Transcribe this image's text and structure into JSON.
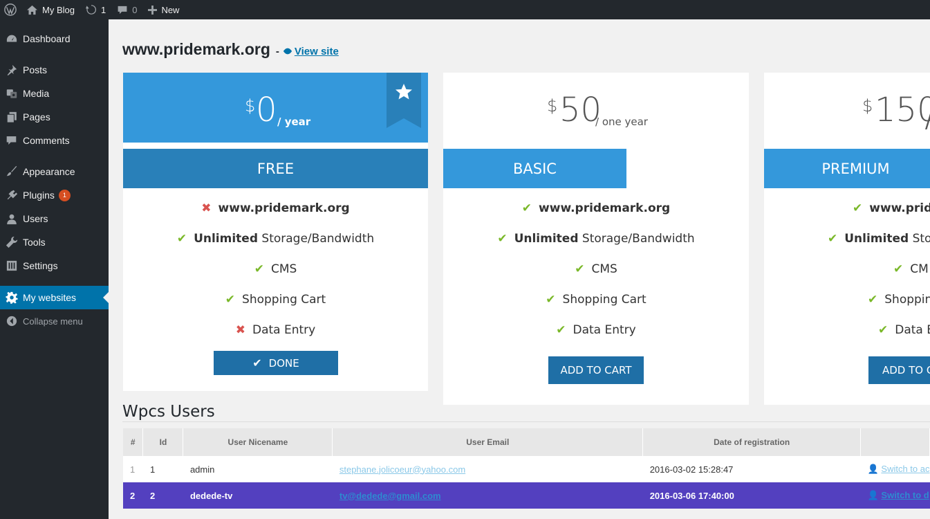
{
  "adminbar": {
    "site_name": "My Blog",
    "updates_count": "1",
    "comments_count": "0",
    "new_label": "New"
  },
  "sidebar": {
    "items": [
      {
        "label": "Dashboard",
        "icon": "dashboard-icon"
      },
      {
        "label": "Posts",
        "icon": "pin-icon"
      },
      {
        "label": "Media",
        "icon": "media-icon"
      },
      {
        "label": "Pages",
        "icon": "pages-icon"
      },
      {
        "label": "Comments",
        "icon": "comment-icon"
      },
      {
        "label": "Appearance",
        "icon": "brush-icon"
      },
      {
        "label": "Plugins",
        "icon": "plug-icon",
        "badge": "1"
      },
      {
        "label": "Users",
        "icon": "user-icon"
      },
      {
        "label": "Tools",
        "icon": "wrench-icon"
      },
      {
        "label": "Settings",
        "icon": "settings-icon"
      },
      {
        "label": "My websites",
        "icon": "gear-icon",
        "active": true
      }
    ],
    "collapse_label": "Collapse menu"
  },
  "page": {
    "title": "www.pridemark.org",
    "separator": "-",
    "view_site": "View site"
  },
  "plans": [
    {
      "currency": "$",
      "amount": "0",
      "period": "/ year",
      "name": "FREE",
      "features": [
        {
          "ok": false,
          "bold": "www.pridemark.org",
          "text": ""
        },
        {
          "ok": true,
          "bold": "Unlimited",
          "text": " Storage/Bandwidth"
        },
        {
          "ok": true,
          "bold": "",
          "text": "CMS"
        },
        {
          "ok": true,
          "bold": "",
          "text": "Shopping Cart"
        },
        {
          "ok": false,
          "bold": "",
          "text": "Data Entry"
        }
      ],
      "button": "DONE"
    },
    {
      "currency": "$",
      "amount": "50",
      "period": "/ one year",
      "name": "BASIC",
      "features": [
        {
          "ok": true,
          "bold": "www.pridemark.org",
          "text": ""
        },
        {
          "ok": true,
          "bold": "Unlimited",
          "text": " Storage/Bandwidth"
        },
        {
          "ok": true,
          "bold": "",
          "text": "CMS"
        },
        {
          "ok": true,
          "bold": "",
          "text": "Shopping Cart"
        },
        {
          "ok": true,
          "bold": "",
          "text": "Data Entry"
        }
      ],
      "button": "ADD TO CART"
    },
    {
      "currency": "$",
      "amount": "150",
      "period": "/",
      "name": "PREMIUM",
      "features": [
        {
          "ok": true,
          "bold": "www.pride",
          "text": ""
        },
        {
          "ok": true,
          "bold": "Unlimited",
          "text": " Stora"
        },
        {
          "ok": true,
          "bold": "",
          "text": "CM"
        },
        {
          "ok": true,
          "bold": "",
          "text": "Shoppin"
        },
        {
          "ok": true,
          "bold": "",
          "text": "Data E"
        }
      ],
      "button": "ADD TO C"
    }
  ],
  "users": {
    "title": "Wpcs Users",
    "columns": [
      "#",
      "Id",
      "User Nicename",
      "User Email",
      "Date of registration",
      ""
    ],
    "rows": [
      {
        "num": "1",
        "id": "1",
        "nicename": "admin",
        "email": "stephane.jolicoeur@yahoo.com",
        "date": "2016-03-02 15:28:47",
        "action": "Switch to ac"
      },
      {
        "num": "2",
        "id": "2",
        "nicename": "dedede-tv",
        "email": "tv@dedede@gmail.com",
        "date": "2016-03-06 17:40:00",
        "action": "Switch to d"
      }
    ]
  },
  "colors": {
    "accent": "#3498db",
    "accent_dark": "#2980b9",
    "button": "#1f6fa6",
    "check": "#7ab829",
    "cross": "#d9534f",
    "selected_row": "#5340bf"
  }
}
